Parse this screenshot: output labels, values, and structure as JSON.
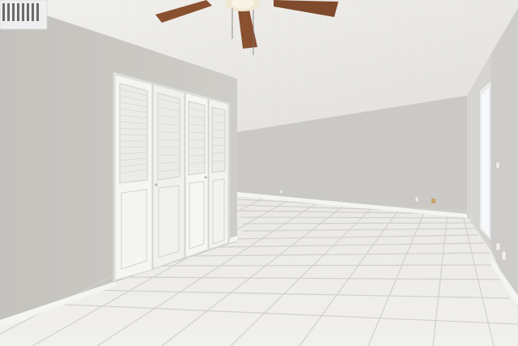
{
  "scene": {
    "description_free": true,
    "palette": {
      "ceiling": "#ecebe8",
      "ceiling_shadow": "#dedcd8",
      "wall_left": "#c8c6c1",
      "wall_back": "#cdcbc7",
      "wall_right": "#d2d0cc",
      "baseboard": "#f6f6f4",
      "floor": "#eeede9",
      "grout": "#d4d2cc",
      "door": "#f3f3f1",
      "door_shadow": "#cfcfcc",
      "fan_blade": "#8a5130",
      "fan_hub": "#e8e2cf",
      "vent": "#efefef"
    },
    "objects": [
      "ceiling-fan-icon",
      "air-vent-icon",
      "closet-bifold-doors",
      "sliding-glass-door",
      "wall-outlet-icon"
    ]
  }
}
